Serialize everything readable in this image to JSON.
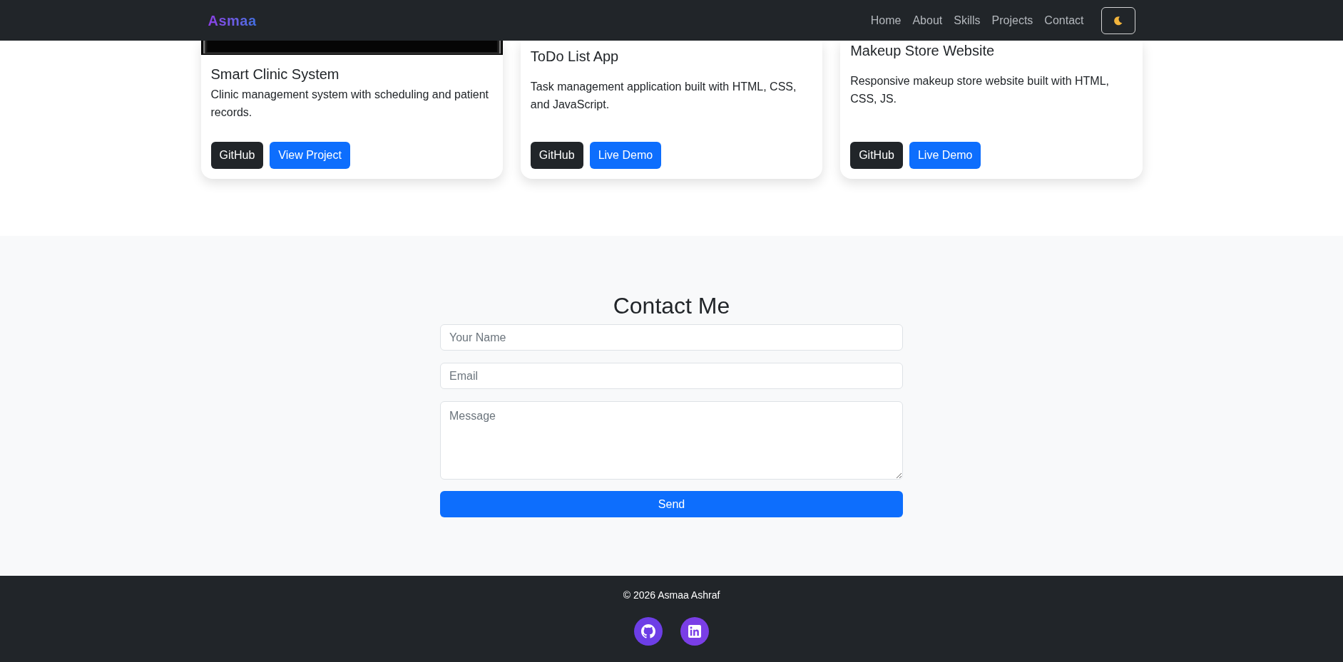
{
  "navbar": {
    "brand": "Asmaa",
    "links": [
      "Home",
      "About",
      "Skills",
      "Projects",
      "Contact"
    ]
  },
  "projects": [
    {
      "has_image": true,
      "title": "Smart Clinic System",
      "description": "Clinic management system with scheduling and patient records.",
      "buttons": [
        "GitHub",
        "View Project"
      ]
    },
    {
      "has_image": false,
      "title": "ToDo List App",
      "description": "Task management application built with HTML, CSS, and JavaScript.",
      "buttons": [
        "GitHub",
        "Live Demo"
      ]
    },
    {
      "has_image": false,
      "title": "Makeup Store Website",
      "description": "Responsive makeup store website built with HTML, CSS, JS.",
      "buttons": [
        "GitHub",
        "Live Demo"
      ]
    }
  ],
  "contact": {
    "title": "Contact Me",
    "fields": [
      {
        "kind": "input",
        "placeholder": "Your Name"
      },
      {
        "kind": "input",
        "placeholder": "Email"
      },
      {
        "kind": "textarea",
        "placeholder": "Message"
      }
    ],
    "submit": "Send"
  },
  "footer": {
    "copyright": "© 2026 Asmaa Ashraf"
  }
}
